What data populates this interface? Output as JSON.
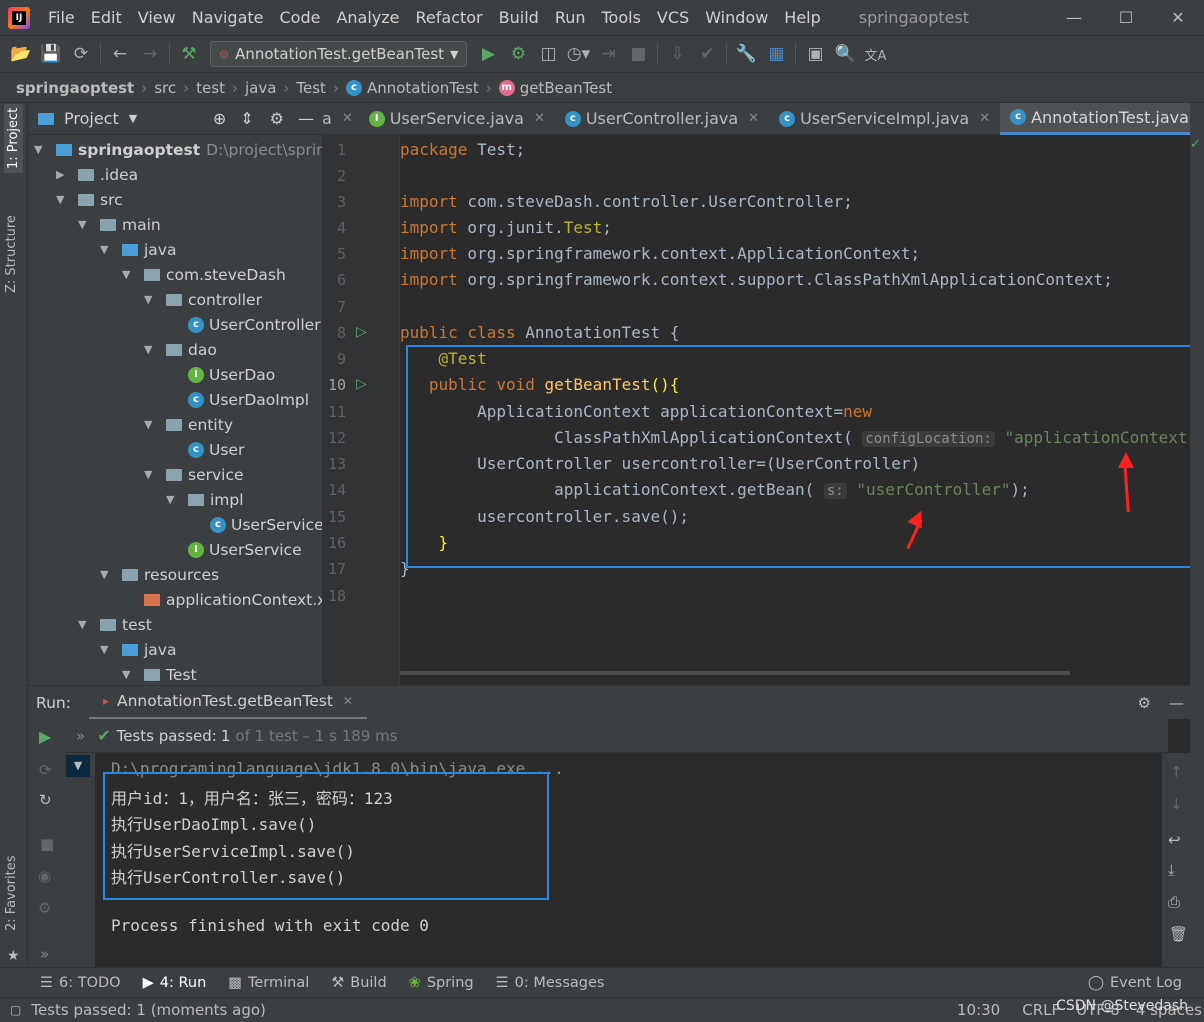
{
  "app": {
    "logo": "IJ",
    "project_title": "springaoptest",
    "menu": [
      "File",
      "Edit",
      "View",
      "Navigate",
      "Code",
      "Analyze",
      "Refactor",
      "Build",
      "Run",
      "Tools",
      "VCS",
      "Window",
      "Help"
    ],
    "window_controls": {
      "minimize": "—",
      "maximize": "☐",
      "close": "✕"
    }
  },
  "toolbar": {
    "run_config": "AnnotationTest.getBeanTest",
    "translate_icon": "文A"
  },
  "breadcrumb": {
    "items": [
      "springaoptest",
      "src",
      "test",
      "java",
      "Test",
      "AnnotationTest",
      "getBeanTest"
    ]
  },
  "left_stripe": {
    "project_tab": "1: Project",
    "structure_tab": "Z: Structure",
    "favorites_tab": "2: Favorites"
  },
  "project_panel": {
    "title": "Project",
    "tree": [
      {
        "label": "springaoptest",
        "extra": "D:\\project\\springaopt",
        "icon": "module",
        "depth": 0,
        "open": true
      },
      {
        "label": ".idea",
        "icon": "folder",
        "depth": 1,
        "open": false
      },
      {
        "label": "src",
        "icon": "folder",
        "depth": 1,
        "open": true
      },
      {
        "label": "main",
        "icon": "folder",
        "depth": 2,
        "open": true
      },
      {
        "label": "java",
        "icon": "src",
        "depth": 3,
        "open": true
      },
      {
        "label": "com.steveDash",
        "icon": "package",
        "depth": 4,
        "open": true
      },
      {
        "label": "controller",
        "icon": "package",
        "depth": 5,
        "open": true
      },
      {
        "label": "UserController",
        "icon": "class",
        "depth": 6
      },
      {
        "label": "dao",
        "icon": "package",
        "depth": 5,
        "open": true
      },
      {
        "label": "UserDao",
        "icon": "interface",
        "depth": 6
      },
      {
        "label": "UserDaoImpl",
        "icon": "class",
        "depth": 6
      },
      {
        "label": "entity",
        "icon": "package",
        "depth": 5,
        "open": true
      },
      {
        "label": "User",
        "icon": "class",
        "depth": 6
      },
      {
        "label": "service",
        "icon": "package",
        "depth": 5,
        "open": true
      },
      {
        "label": "impl",
        "icon": "package",
        "depth": 6,
        "open": true
      },
      {
        "label": "UserServiceImp",
        "icon": "class",
        "depth": 7
      },
      {
        "label": "UserService",
        "icon": "interface",
        "depth": 6
      },
      {
        "label": "resources",
        "icon": "folder",
        "depth": 3,
        "open": true
      },
      {
        "label": "applicationContext.xml",
        "icon": "xml",
        "depth": 4
      },
      {
        "label": "test",
        "icon": "folder",
        "depth": 2,
        "open": true
      },
      {
        "label": "java",
        "icon": "src",
        "depth": 3,
        "open": true
      },
      {
        "label": "Test",
        "icon": "package",
        "depth": 4,
        "open": true
      }
    ]
  },
  "editor": {
    "tabs": [
      {
        "label": "a",
        "icon": "none",
        "partial": true
      },
      {
        "label": "UserService.java",
        "icon": "interface"
      },
      {
        "label": "UserController.java",
        "icon": "class"
      },
      {
        "label": "UserServiceImpl.java",
        "icon": "class"
      },
      {
        "label": "AnnotationTest.java",
        "icon": "class",
        "active": true
      }
    ],
    "line_numbers": [
      "1",
      "2",
      "3",
      "4",
      "5",
      "6",
      "7",
      "8",
      "9",
      "10",
      "11",
      "12",
      "13",
      "14",
      "15",
      "16",
      "17",
      "18"
    ],
    "hints": {
      "config_location": "configLocation:",
      "s": "s:"
    }
  },
  "run_panel": {
    "label": "Run:",
    "tab": "AnnotationTest.getBeanTest",
    "status_prefix": "Tests passed:",
    "status_count": "1",
    "status_detail": "of 1 test – 1 s 189 ms",
    "console": [
      "D:\\programinglanguage\\jdk1.8.0\\bin\\java.exe ...",
      "用户id：1，用户名：张三，密码：123",
      "执行UserDaoImpl.save()",
      "执行UserServiceImpl.save()",
      "执行UserController.save()",
      "",
      "Process finished with exit code 0"
    ]
  },
  "bottom_tabs": [
    {
      "label": "6: TODO",
      "icon": "list-icon"
    },
    {
      "label": "4: Run",
      "icon": "run-icon",
      "active": true
    },
    {
      "label": "Terminal",
      "icon": "terminal-icon"
    },
    {
      "label": "Build",
      "icon": "hammer-icon"
    },
    {
      "label": "Spring",
      "icon": "spring-icon"
    },
    {
      "label": "0: Messages",
      "icon": "messages-icon"
    }
  ],
  "event_log": "Event Log",
  "status_bar": {
    "message": "Tests passed: 1 (moments ago)",
    "position": "10:30",
    "line_sep": "CRLF",
    "encoding": "UTF-8",
    "indent": "4 spaces",
    "watermark": "CSDN @Stevedash"
  },
  "colors": {
    "accent": "#4a88c7",
    "highlight_box": "#2a86e8",
    "arrow": "#ff2020",
    "pass": "#59a869"
  }
}
